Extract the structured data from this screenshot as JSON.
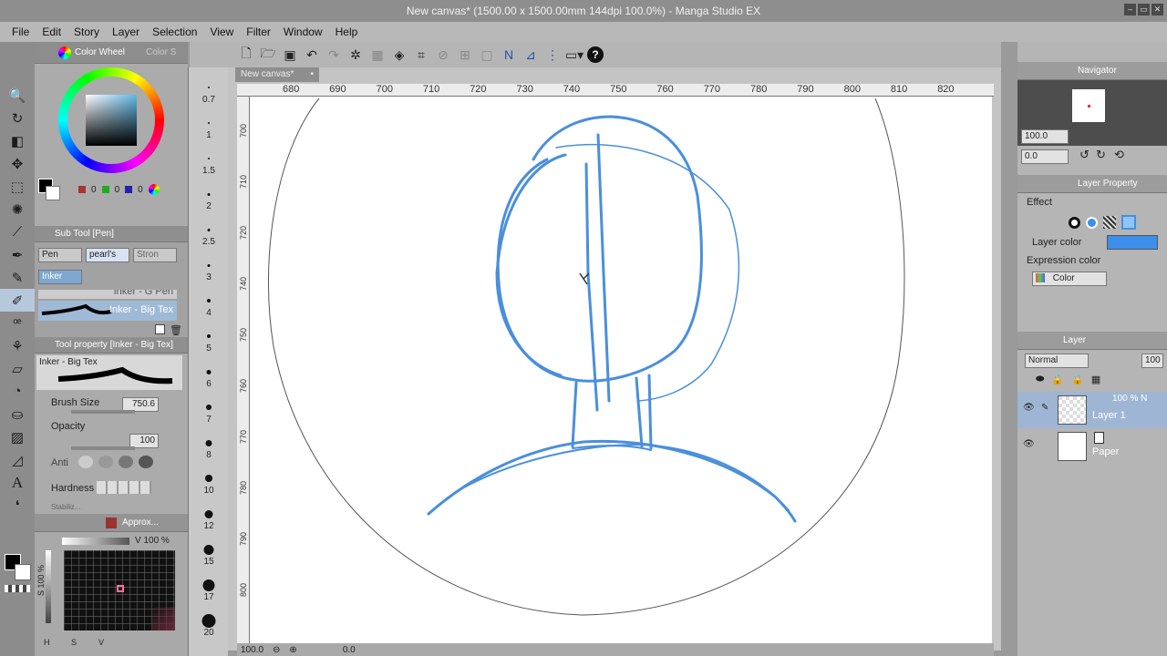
{
  "window": {
    "title": "New canvas* (1500.00 x 1500.00mm 144dpi 100.0%) - Manga Studio EX",
    "controls": [
      "‒",
      "▭",
      "✕"
    ]
  },
  "menu": [
    "File",
    "Edit",
    "Story",
    "Layer",
    "Selection",
    "View",
    "Filter",
    "Window",
    "Help"
  ],
  "toolbar": {
    "help_label": "?"
  },
  "color_wheel": {
    "title": "Color Wheel",
    "tab2": "Color S",
    "values": [
      "0",
      "0",
      "0"
    ]
  },
  "sub_tool": {
    "title": "Sub Tool [Pen]",
    "tabs": [
      "Pen",
      "pearl's",
      "Stron"
    ],
    "active_tab": "Inker",
    "items": [
      "Inker - G Pen",
      "Inker - Big Tex"
    ]
  },
  "tool_property": {
    "title": "Tool property [Inker - Big Tex]",
    "preview_label": "Inker - Big Tex",
    "brush_size_label": "Brush Size",
    "brush_size_value": "750.6",
    "opacity_label": "Opacity",
    "opacity_value": "100",
    "anti_label": "Anti",
    "hardness_label": "Hardness",
    "stabilize_label": "Stabiliz..."
  },
  "approx_color": {
    "title": "Approx...",
    "v_label": "V 100 %",
    "s_label": "S 100 %",
    "h_label": "H",
    "s_btn": "S",
    "v_btn": "V"
  },
  "brush_sizes": [
    "0.7",
    "1",
    "1.5",
    "2",
    "2.5",
    "3",
    "4",
    "5",
    "6",
    "7",
    "8",
    "10",
    "12",
    "15",
    "17",
    "20"
  ],
  "canvas": {
    "tab": "New canvas*",
    "ruler_h": [
      "680",
      "690",
      "700",
      "710",
      "720",
      "730",
      "740",
      "750",
      "760",
      "770",
      "780",
      "790",
      "800",
      "810",
      "820"
    ],
    "ruler_v": [
      "700",
      "710",
      "720",
      "740",
      "750",
      "760",
      "770",
      "780",
      "790",
      "800"
    ],
    "stroke_color": "#4a8fdc"
  },
  "status": {
    "zoom": "100.0",
    "rotation": "0.0"
  },
  "navigator": {
    "title": "Navigator",
    "zoom": "100.0",
    "angle": "0.0"
  },
  "layer_property": {
    "title": "Layer Property",
    "effect_label": "Effect",
    "layer_color_label": "Layer color",
    "layer_color": "#3b8fea",
    "expression_label": "Expression color",
    "expression_value": "Color"
  },
  "layer_panel": {
    "title": "Layer",
    "blend_mode": "Normal",
    "opacity": "100",
    "layers": [
      {
        "opacity": "100 % N",
        "name": "Layer 1"
      },
      {
        "opacity": "",
        "name": "Paper"
      }
    ]
  }
}
